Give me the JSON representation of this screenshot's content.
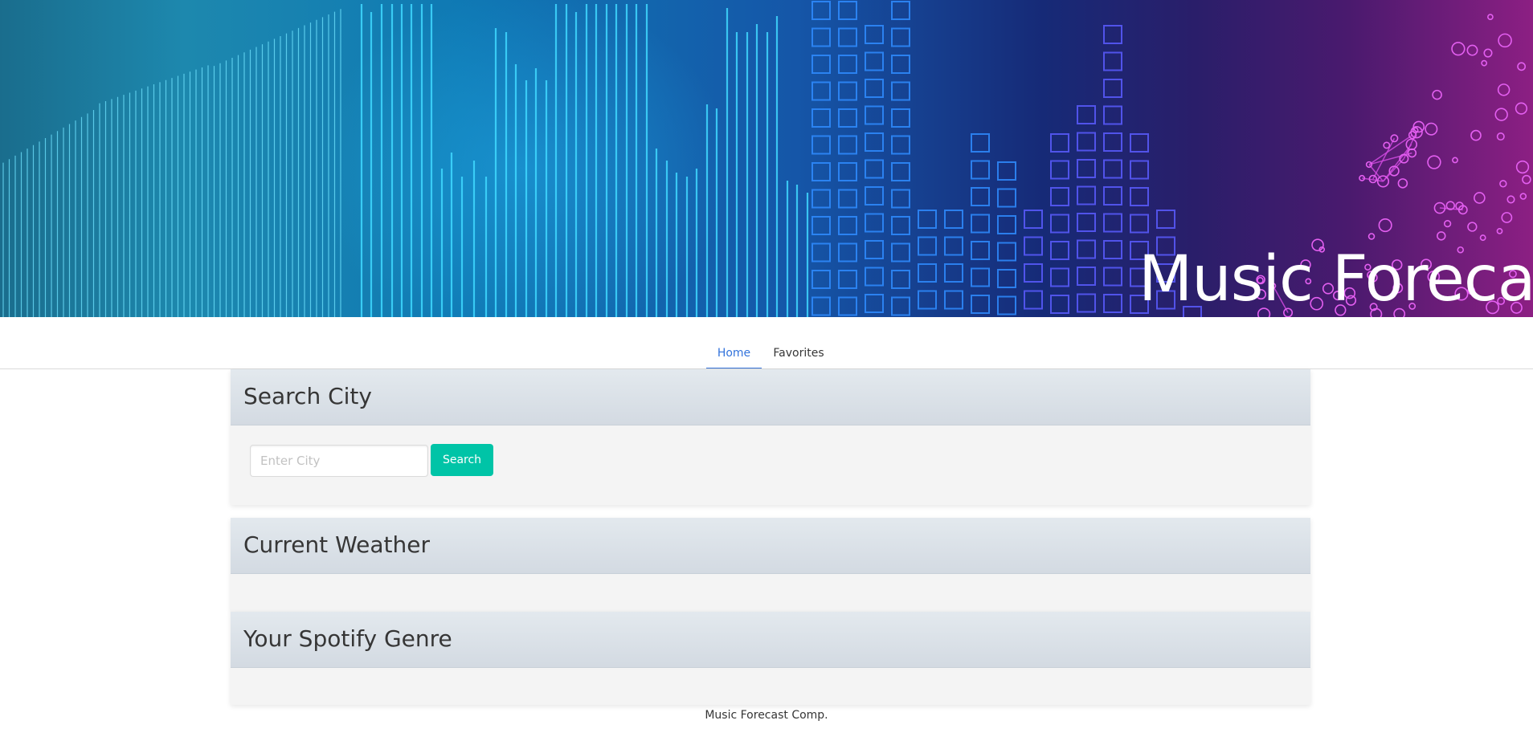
{
  "hero": {
    "title": "Music Forecast"
  },
  "nav": {
    "tabs": [
      {
        "label": "Home",
        "active": true
      },
      {
        "label": "Favorites",
        "active": false
      }
    ]
  },
  "search": {
    "title": "Search City",
    "placeholder": "Enter City",
    "value": "",
    "button_label": "Search"
  },
  "weather": {
    "title": "Current Weather"
  },
  "genre": {
    "title": "Your Spotify Genre"
  },
  "footer": {
    "text": "Music Forecast Comp."
  },
  "colors": {
    "accent": "#3273dc",
    "button": "#00c4a7",
    "hero_left": "#1d88ae",
    "hero_right": "#8c1f83"
  }
}
